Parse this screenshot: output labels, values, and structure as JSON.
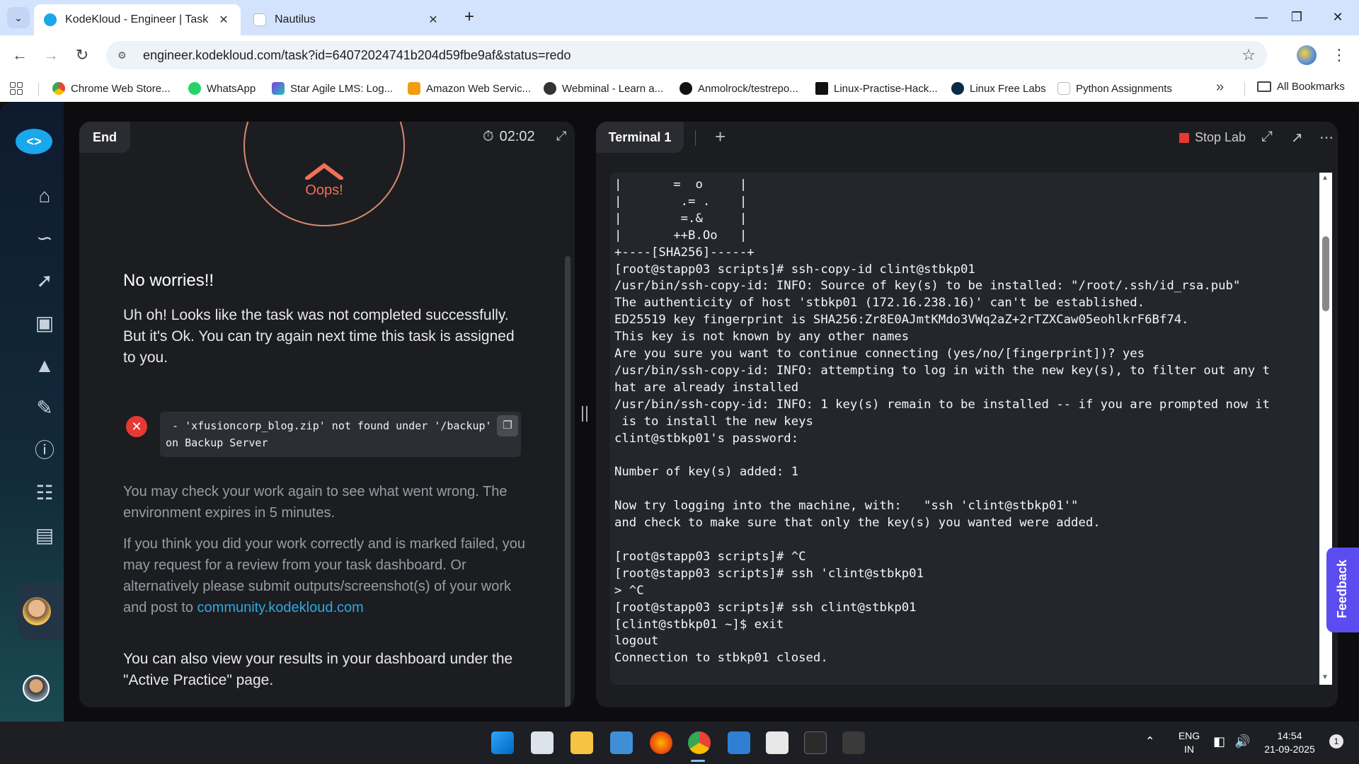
{
  "browser": {
    "tabs": [
      {
        "title": "KodeKloud - Engineer | Task",
        "active": true
      },
      {
        "title": "Nautilus",
        "active": false
      }
    ],
    "url": "engineer.kodekloud.com/task?id=64072024741b204d59fbe9af&status=redo",
    "bookmarks": [
      "Chrome Web Store...",
      "WhatsApp",
      "Star Agile LMS: Log...",
      "Amazon Web Servic...",
      "Webminal - Learn a...",
      "Anmolrock/testrepo...",
      "Linux-Practise-Hack...",
      "Linux Free Labs",
      "Python Assignments"
    ],
    "all_bookmarks": "All Bookmarks"
  },
  "task_panel": {
    "tab_label": "End",
    "timer": "02:02",
    "oops": "Oops!",
    "heading": "No worries!!",
    "main_text": "Uh oh! Looks like the task was not completed successfully. But it's Ok. You can try again next time this task is assigned to you.",
    "error_text": " - 'xfusioncorp_blog.zip' not found under '/backup'\non Backup Server",
    "check_text": "You may check your work again to see what went wrong. The environment expires in 5 minutes.",
    "review_text": "If you think you did your work correctly and is marked failed, you may request for a review from your task dashboard. Or alternatively please submit outputs/screenshot(s) of your work and post to ",
    "community_link": "community.kodekloud.com",
    "bottom_text": "You can also view your results in your dashboard under the \"Active Practice\" page."
  },
  "terminal_panel": {
    "tab_label": "Terminal 1",
    "stop_lab": "Stop Lab",
    "output": "|       =  o     |\n|        .= .    |\n|        =.&     |\n|       ++B.Oo   |\n+----[SHA256]-----+\n[root@stapp03 scripts]# ssh-copy-id clint@stbkp01\n/usr/bin/ssh-copy-id: INFO: Source of key(s) to be installed: \"/root/.ssh/id_rsa.pub\"\nThe authenticity of host 'stbkp01 (172.16.238.16)' can't be established.\nED25519 key fingerprint is SHA256:Zr8E0AJmtKMdo3VWq2aZ+2rTZXCaw05eohlkrF6Bf74.\nThis key is not known by any other names\nAre you sure you want to continue connecting (yes/no/[fingerprint])? yes\n/usr/bin/ssh-copy-id: INFO: attempting to log in with the new key(s), to filter out any t\nhat are already installed\n/usr/bin/ssh-copy-id: INFO: 1 key(s) remain to be installed -- if you are prompted now it\n is to install the new keys\nclint@stbkp01's password:\n\nNumber of key(s) added: 1\n\nNow try logging into the machine, with:   \"ssh 'clint@stbkp01'\"\nand check to make sure that only the key(s) you wanted were added.\n\n[root@stapp03 scripts]# ^C\n[root@stapp03 scripts]# ssh 'clint@stbkp01\n> ^C\n[root@stapp03 scripts]# ssh clint@stbkp01\n[clint@stbkp01 ~]$ exit\nlogout\nConnection to stbkp01 closed."
  },
  "feedback": "Feedback",
  "taskbar": {
    "lang": "ENG",
    "region": "IN",
    "time": "14:54",
    "date": "21-09-2025",
    "notifications": "1"
  }
}
